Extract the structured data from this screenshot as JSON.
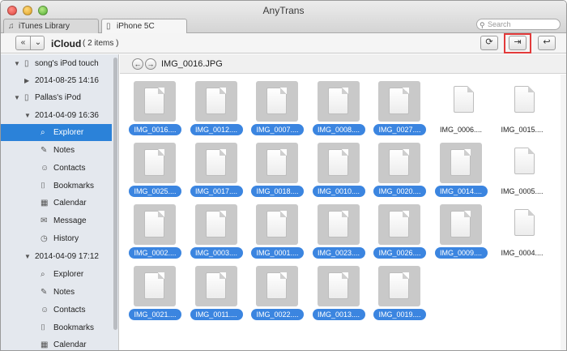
{
  "app": {
    "title": "AnyTrans",
    "search_placeholder": "Search",
    "tabs": [
      {
        "label": "iTunes Library",
        "icon": "music-note-icon"
      },
      {
        "label": "iPhone 5C",
        "icon": "phone-icon"
      }
    ]
  },
  "toolbar": {
    "back": "«",
    "dropdown": "⌄",
    "location": "iCloud",
    "count": "( 2 items )",
    "refresh_icon": "⟳",
    "to_computer_icon": "⇥",
    "exit_icon": "↩"
  },
  "sidebar": {
    "items": [
      {
        "label": "song's iPod touch",
        "icon": "▯",
        "tri": "▼"
      },
      {
        "label": "2014-08-25 14:16",
        "icon": "",
        "tri": "▶"
      },
      {
        "label": "Pallas's iPod",
        "icon": "▯",
        "tri": "▼"
      },
      {
        "label": "2014-04-09 16:36",
        "icon": "",
        "tri": "▼"
      },
      {
        "label": "Explorer",
        "icon": "⌕",
        "tri": ""
      },
      {
        "label": "Notes",
        "icon": "✎",
        "tri": ""
      },
      {
        "label": "Contacts",
        "icon": "☺",
        "tri": ""
      },
      {
        "label": "Bookmarks",
        "icon": "⌷",
        "tri": ""
      },
      {
        "label": "Calendar",
        "icon": "▦",
        "tri": ""
      },
      {
        "label": "Message",
        "icon": "✉",
        "tri": ""
      },
      {
        "label": "History",
        "icon": "◷",
        "tri": ""
      },
      {
        "label": "2014-04-09 17:12",
        "icon": "",
        "tri": "▼"
      },
      {
        "label": "Explorer",
        "icon": "⌕",
        "tri": ""
      },
      {
        "label": "Notes",
        "icon": "✎",
        "tri": ""
      },
      {
        "label": "Contacts",
        "icon": "☺",
        "tri": ""
      },
      {
        "label": "Bookmarks",
        "icon": "⌷",
        "tri": ""
      },
      {
        "label": "Calendar",
        "icon": "▦",
        "tri": ""
      }
    ]
  },
  "pathbar": {
    "back": "←",
    "forward": "→",
    "title": "IMG_0016.JPG"
  },
  "files": [
    {
      "name": "IMG_0016....",
      "selected": true
    },
    {
      "name": "IMG_0012....",
      "selected": true
    },
    {
      "name": "IMG_0007....",
      "selected": true
    },
    {
      "name": "IMG_0008....",
      "selected": true
    },
    {
      "name": "IMG_0027....",
      "selected": true
    },
    {
      "name": "IMG_0006....",
      "selected": false
    },
    {
      "name": "IMG_0015....",
      "selected": false
    },
    {
      "name": "IMG_0025....",
      "selected": true
    },
    {
      "name": "IMG_0017....",
      "selected": true
    },
    {
      "name": "IMG_0018....",
      "selected": true
    },
    {
      "name": "IMG_0010....",
      "selected": true
    },
    {
      "name": "IMG_0020....",
      "selected": true
    },
    {
      "name": "IMG_0014....",
      "selected": true
    },
    {
      "name": "IMG_0005....",
      "selected": false
    },
    {
      "name": "IMG_0002....",
      "selected": true
    },
    {
      "name": "IMG_0003....",
      "selected": true
    },
    {
      "name": "IMG_0001....",
      "selected": true
    },
    {
      "name": "IMG_0023....",
      "selected": true
    },
    {
      "name": "IMG_0026....",
      "selected": true
    },
    {
      "name": "IMG_0009....",
      "selected": true
    },
    {
      "name": "IMG_0004....",
      "selected": false
    },
    {
      "name": "IMG_0021....",
      "selected": true
    },
    {
      "name": "IMG_0011....",
      "selected": true
    },
    {
      "name": "IMG_0022....",
      "selected": true
    },
    {
      "name": "IMG_0013....",
      "selected": true
    },
    {
      "name": "IMG_0019....",
      "selected": true
    }
  ],
  "colors": {
    "selection_blue": "#3b85e0",
    "sidebar_selected": "#2b82d9",
    "highlight_red": "#e23a3a"
  }
}
